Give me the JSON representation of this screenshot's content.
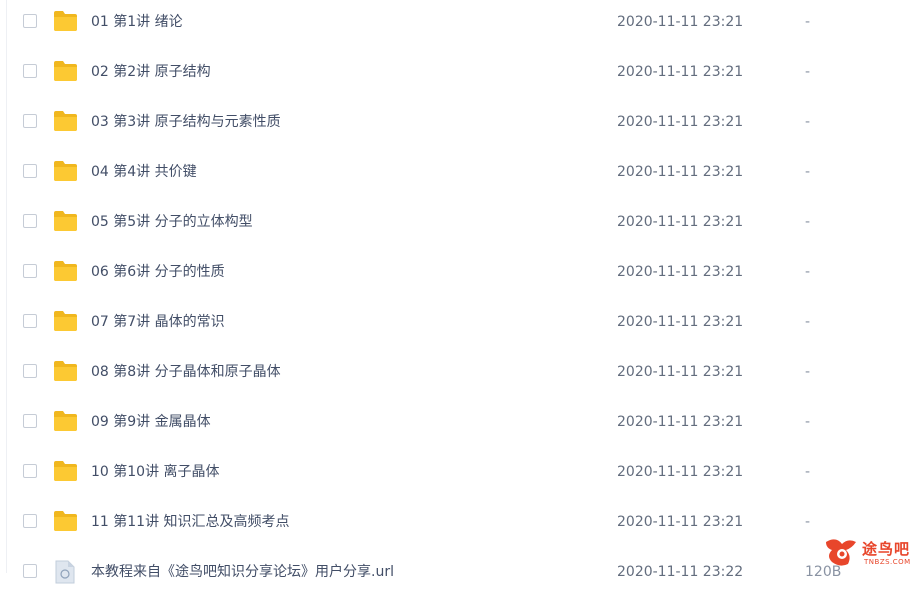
{
  "rows": [
    {
      "name": "01 第1讲 绪论",
      "date": "2020-11-11 23:21",
      "size": "-"
    },
    {
      "name": "02 第2讲 原子结构",
      "date": "2020-11-11 23:21",
      "size": "-"
    },
    {
      "name": "03 第3讲 原子结构与元素性质",
      "date": "2020-11-11 23:21",
      "size": "-"
    },
    {
      "name": "04 第4讲 共价键",
      "date": "2020-11-11 23:21",
      "size": "-"
    },
    {
      "name": "05 第5讲 分子的立体构型",
      "date": "2020-11-11 23:21",
      "size": "-"
    },
    {
      "name": "06 第6讲 分子的性质",
      "date": "2020-11-11 23:21",
      "size": "-"
    },
    {
      "name": "07 第7讲 晶体的常识",
      "date": "2020-11-11 23:21",
      "size": "-"
    },
    {
      "name": "08 第8讲 分子晶体和原子晶体",
      "date": "2020-11-11 23:21",
      "size": "-"
    },
    {
      "name": "09 第9讲 金属晶体",
      "date": "2020-11-11 23:21",
      "size": "-"
    },
    {
      "name": "10 第10讲 离子晶体",
      "date": "2020-11-11 23:21",
      "size": "-"
    },
    {
      "name": "11 第11讲 知识汇总及高频考点",
      "date": "2020-11-11 23:21",
      "size": "-"
    },
    {
      "name": "本教程来自《途鸟吧知识分享论坛》用户分享.url",
      "date": "2020-11-11 23:22",
      "size": "120B"
    }
  ],
  "icons": {
    "folder": "folder-icon",
    "file": "url-file-icon"
  },
  "colors": {
    "folder": "#fcc933",
    "folder_back": "#f0b71f",
    "watermark": "#e8462b"
  },
  "watermark": {
    "text": "途鸟吧",
    "url": "TNBZS.COM"
  }
}
